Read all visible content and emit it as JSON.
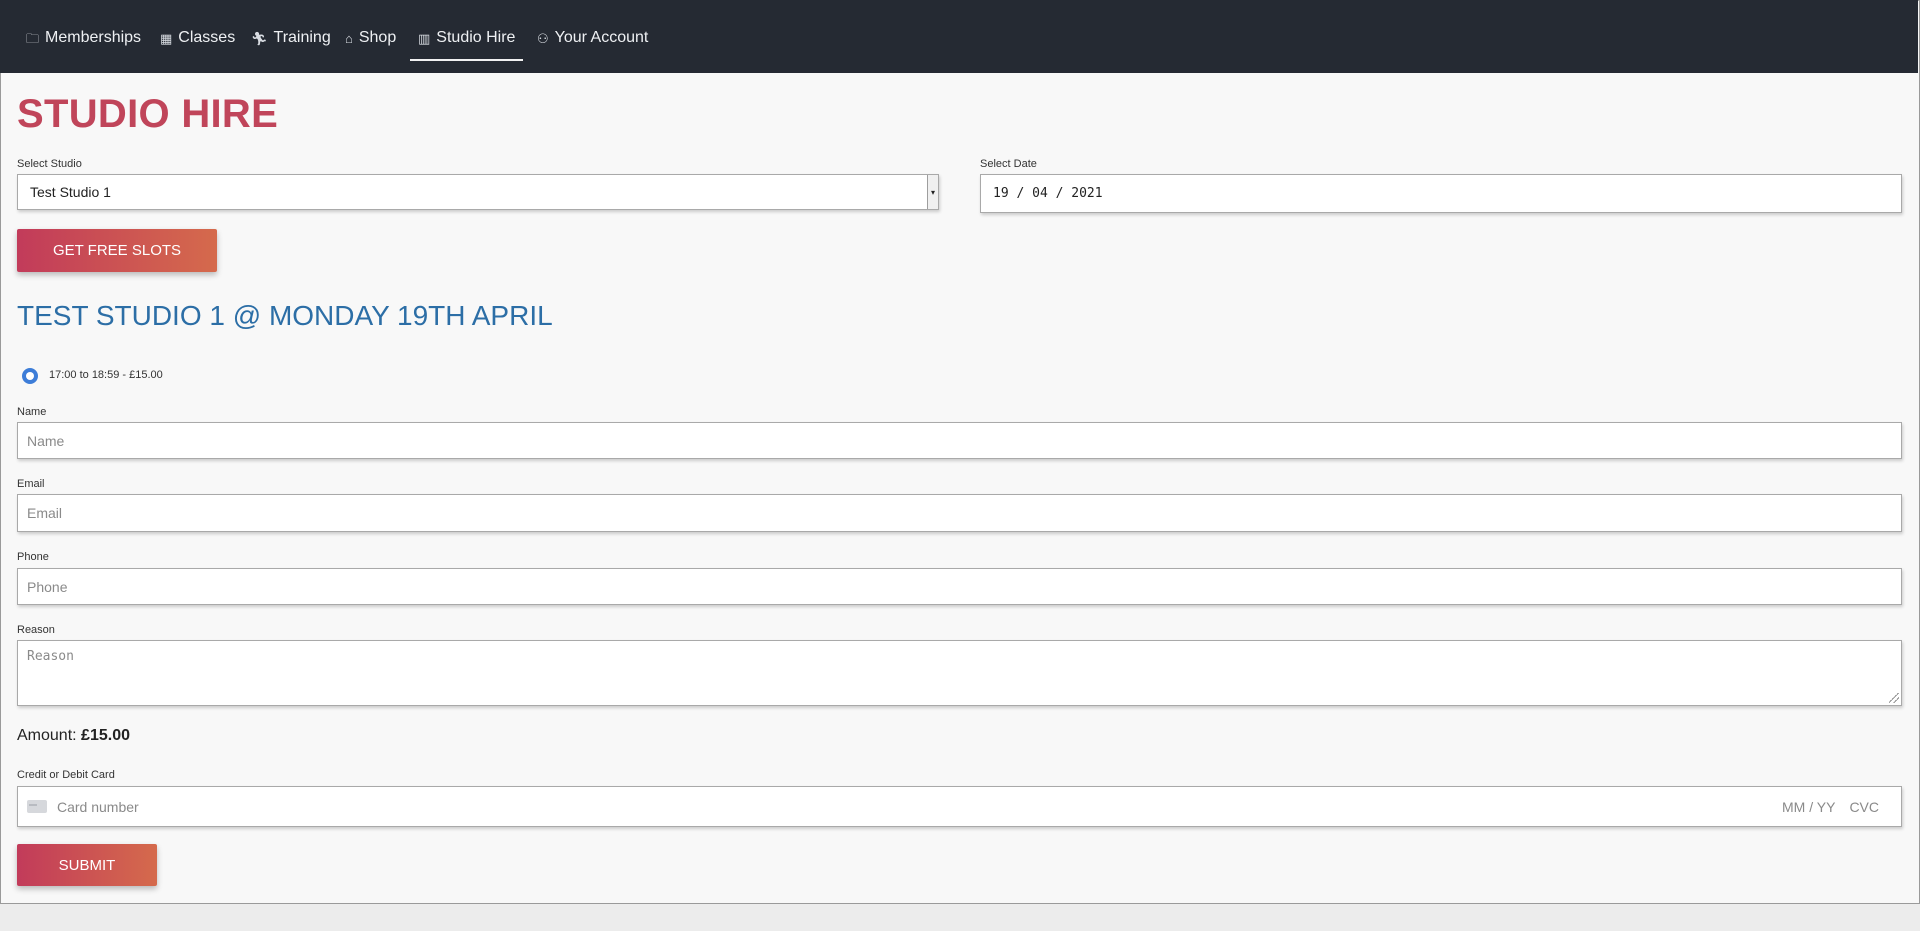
{
  "nav": {
    "items": [
      {
        "label": "Memberships",
        "icon": "folder-icon",
        "glyph": "🗀"
      },
      {
        "label": "Classes",
        "icon": "calendar-icon",
        "glyph": "▦"
      },
      {
        "label": "Training",
        "icon": "running-icon",
        "glyph": "🏃︎"
      },
      {
        "label": "Shop",
        "icon": "basket-icon",
        "glyph": "⌂"
      },
      {
        "label": "Studio Hire",
        "icon": "building-icon",
        "glyph": "▥"
      },
      {
        "label": "Your Account",
        "icon": "user-icon",
        "glyph": "⚇"
      }
    ],
    "active": "Studio Hire"
  },
  "page": {
    "title": "STUDIO HIRE"
  },
  "form": {
    "studio_label": "Select Studio",
    "studio_value": "Test Studio 1",
    "date_label": "Select Date",
    "date_value": "19 / 04 / 2021",
    "get_slots_label": "GET FREE SLOTS",
    "slot_heading": "TEST STUDIO 1 @ MONDAY 19TH APRIL",
    "slot_option": "17:00 to 18:59 - £15.00",
    "name_label": "Name",
    "name_placeholder": "Name",
    "email_label": "Email",
    "email_placeholder": "Email",
    "phone_label": "Phone",
    "phone_placeholder": "Phone",
    "reason_label": "Reason",
    "reason_placeholder": "Reason",
    "amount_label": "Amount:",
    "amount_value": "£15.00",
    "card_label": "Credit or Debit Card",
    "card_placeholder": "Card number",
    "card_expiry": "MM / YY",
    "card_cvc": "CVC",
    "submit_label": "SUBMIT"
  },
  "colors": {
    "nav_bg": "#252a33",
    "title": "#c0455a",
    "heading_blue": "#2c6ea6",
    "button_start": "#c23b5a",
    "button_end": "#d56a4c",
    "radio": "#3d7dd8"
  }
}
